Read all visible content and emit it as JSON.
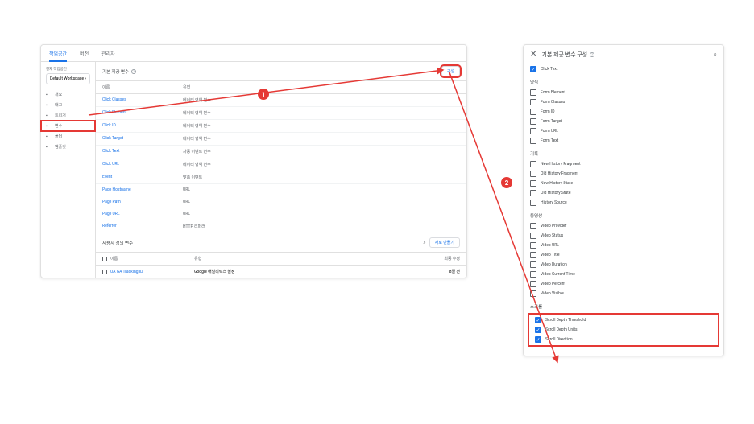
{
  "left": {
    "tabs": [
      "작업공간",
      "버전",
      "관리자"
    ],
    "workspace_label": "현재 작업공간",
    "workspace_value": "Default Workspace",
    "sidebar": [
      {
        "label": "개요",
        "icon": "dashboard"
      },
      {
        "label": "태그",
        "icon": "tag"
      },
      {
        "label": "트리거",
        "icon": "trigger"
      },
      {
        "label": "변수",
        "icon": "variable",
        "highlighted": true
      },
      {
        "label": "폴더",
        "icon": "folder"
      },
      {
        "label": "템플릿",
        "icon": "template"
      }
    ],
    "builtin_title": "기본 제공 변수",
    "config_label": "구성",
    "col_name": "이름",
    "col_type": "유형",
    "builtin_rows": [
      {
        "name": "Click Classes",
        "type": "데이터 영역 변수"
      },
      {
        "name": "Click Element",
        "type": "데이터 영역 변수"
      },
      {
        "name": "Click ID",
        "type": "데이터 영역 변수"
      },
      {
        "name": "Click Target",
        "type": "데이터 영역 변수"
      },
      {
        "name": "Click Text",
        "type": "자동 이벤트 변수"
      },
      {
        "name": "Click URL",
        "type": "데이터 영역 변수"
      },
      {
        "name": "Event",
        "type": "맞춤 이벤트"
      },
      {
        "name": "Page Hostname",
        "type": "URL"
      },
      {
        "name": "Page Path",
        "type": "URL"
      },
      {
        "name": "Page URL",
        "type": "URL"
      },
      {
        "name": "Referrer",
        "type": "HTTP 리퍼러"
      }
    ],
    "user_title": "사용자 정의 변수",
    "new_label": "새로 만들기",
    "col_last": "최종 수정",
    "user_rows": [
      {
        "name": "UA GA Tracking ID",
        "type": "Google 애널리틱스 설정",
        "last": "8일 전"
      }
    ]
  },
  "right": {
    "title": "기본 제공 변수 구성",
    "top_checked": {
      "label": "Click Text",
      "checked": true
    },
    "sections": [
      {
        "label": "양식",
        "items": [
          {
            "label": "Form Element",
            "checked": false
          },
          {
            "label": "Form Classes",
            "checked": false
          },
          {
            "label": "Form ID",
            "checked": false
          },
          {
            "label": "Form Target",
            "checked": false
          },
          {
            "label": "Form URL",
            "checked": false
          },
          {
            "label": "Form Text",
            "checked": false
          }
        ]
      },
      {
        "label": "기록",
        "items": [
          {
            "label": "New History Fragment",
            "checked": false
          },
          {
            "label": "Old History Fragment",
            "checked": false
          },
          {
            "label": "New History State",
            "checked": false
          },
          {
            "label": "Old History State",
            "checked": false
          },
          {
            "label": "History Source",
            "checked": false
          }
        ]
      },
      {
        "label": "동영상",
        "items": [
          {
            "label": "Video Provider",
            "checked": false
          },
          {
            "label": "Video Status",
            "checked": false
          },
          {
            "label": "Video URL",
            "checked": false
          },
          {
            "label": "Video Title",
            "checked": false
          },
          {
            "label": "Video Duration",
            "checked": false
          },
          {
            "label": "Video Current Time",
            "checked": false
          },
          {
            "label": "Video Percent",
            "checked": false
          },
          {
            "label": "Video Visible",
            "checked": false
          }
        ]
      },
      {
        "label": "스크롤",
        "highlighted": true,
        "items": [
          {
            "label": "Scroll Depth Threshold",
            "checked": true
          },
          {
            "label": "Scroll Depth Units",
            "checked": true
          },
          {
            "label": "Scroll Direction",
            "checked": true
          }
        ]
      }
    ]
  },
  "annotations": {
    "badge1": "1",
    "badge2": "2"
  }
}
